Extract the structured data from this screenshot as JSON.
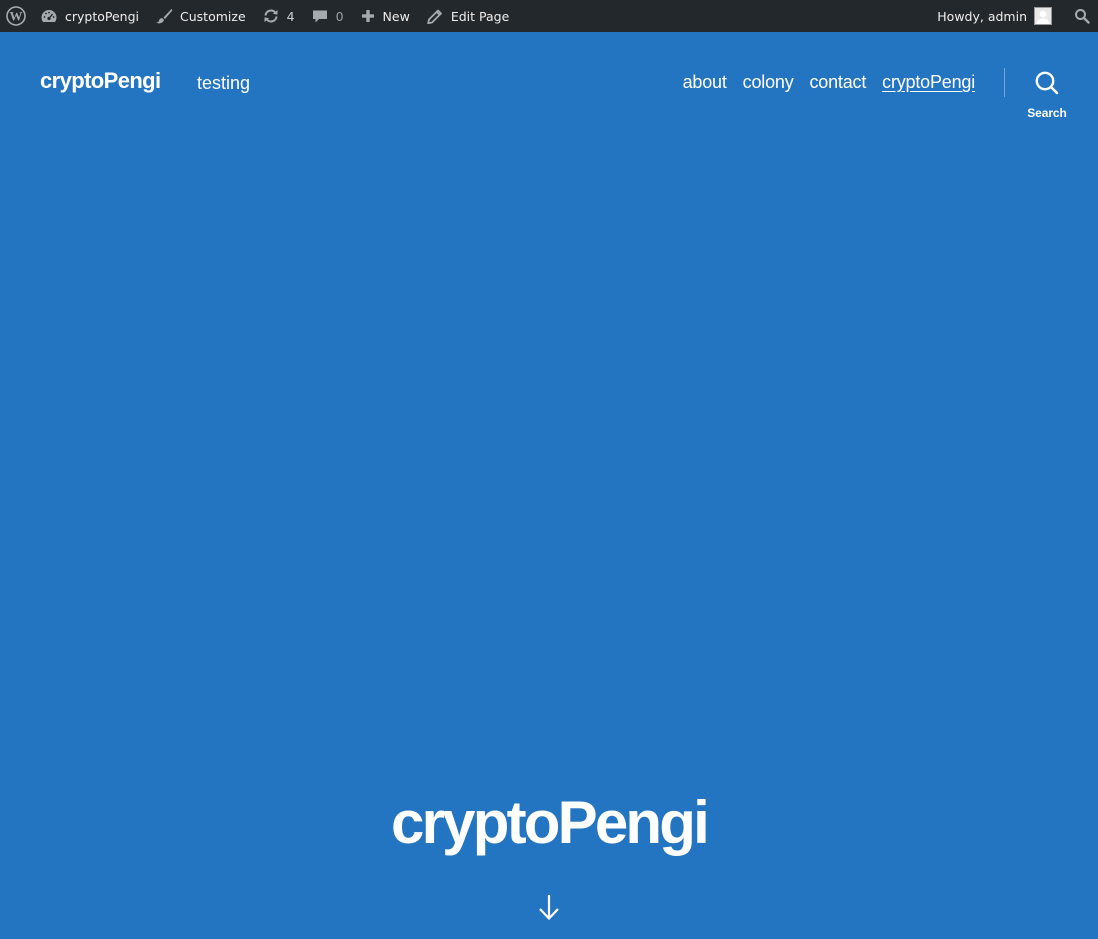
{
  "admin_bar": {
    "site_name": "cryptoPengi",
    "customize_label": "Customize",
    "updates_count": "4",
    "comments_count": "0",
    "new_label": "New",
    "edit_label": "Edit Page",
    "howdy_label": "Howdy, admin"
  },
  "header": {
    "site_title": "cryptoPengi",
    "tagline": "testing",
    "nav": [
      {
        "label": "about"
      },
      {
        "label": "colony"
      },
      {
        "label": "contact"
      },
      {
        "label": "cryptoPengi",
        "current": true
      }
    ],
    "search_label": "Search"
  },
  "hero": {
    "title": "cryptoPengi"
  },
  "colors": {
    "background": "#2475c1",
    "admin_bar": "#23282d",
    "text": "#ffffff"
  }
}
